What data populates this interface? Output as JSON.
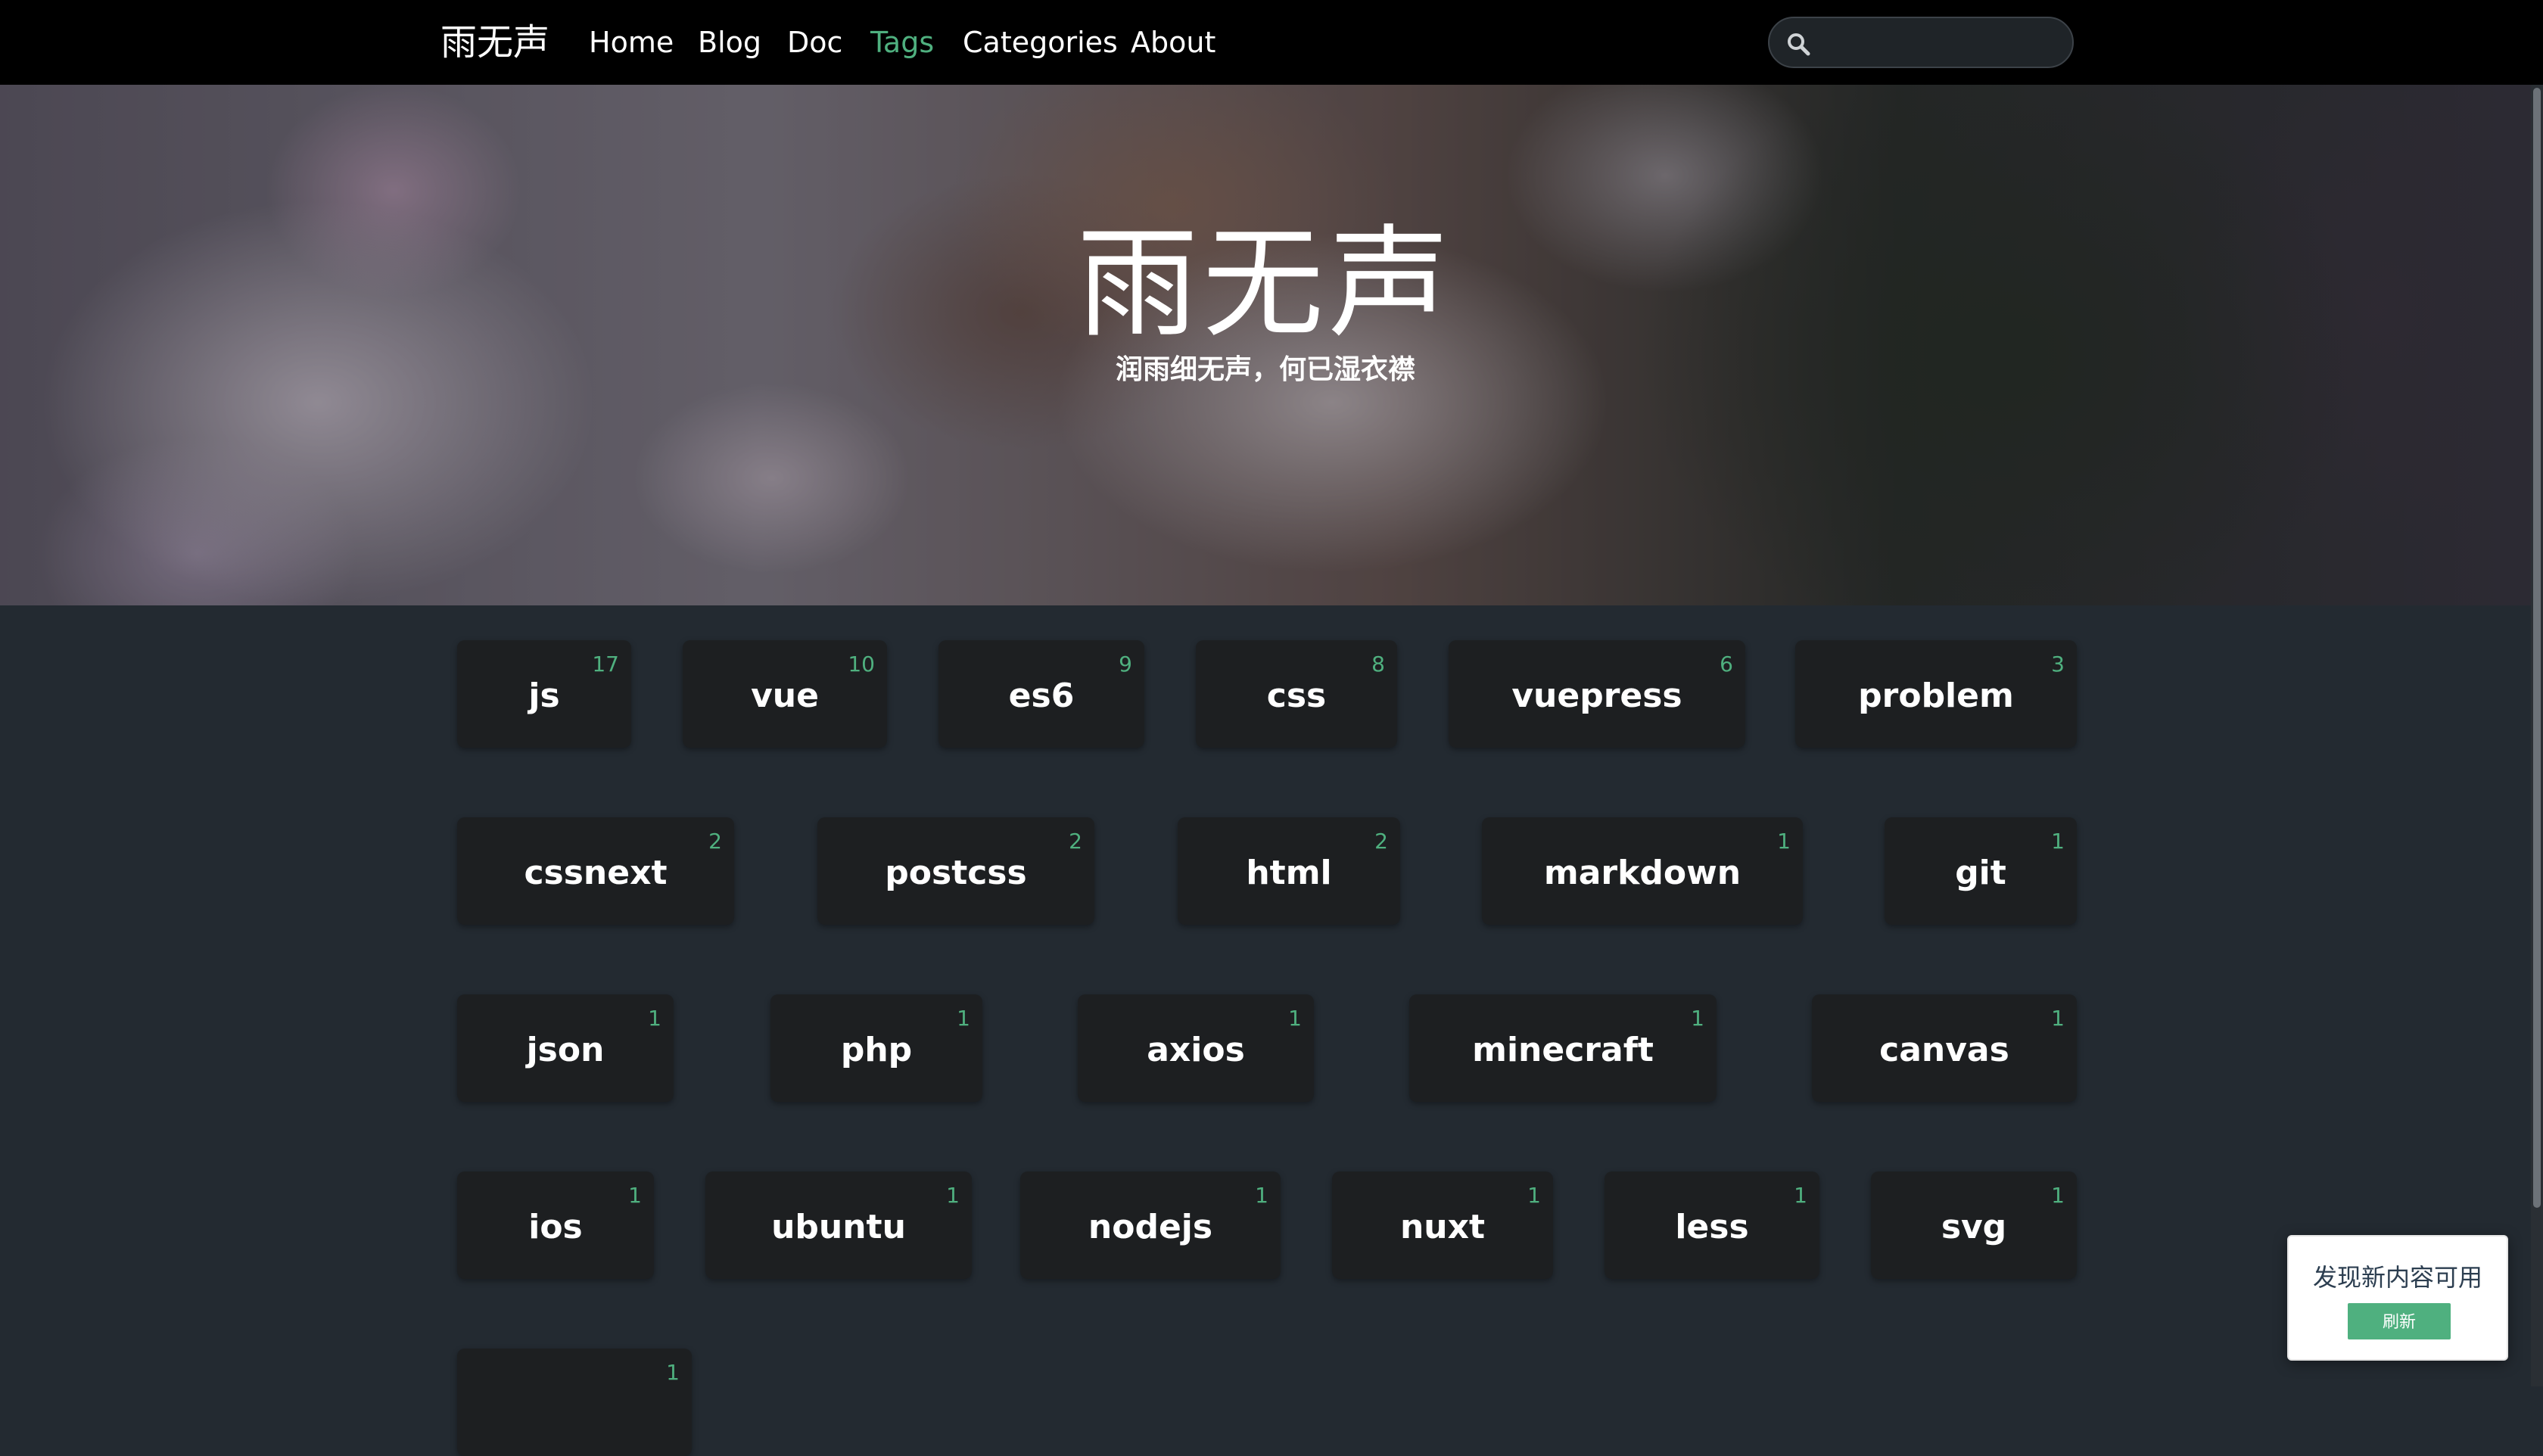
{
  "nav": {
    "brand": "雨无声",
    "links": [
      {
        "label": "Home",
        "active": false
      },
      {
        "label": "Blog",
        "active": false
      },
      {
        "label": "Doc",
        "active": false
      },
      {
        "label": "Tags",
        "active": true
      },
      {
        "label": "Categories",
        "active": false
      },
      {
        "label": "About",
        "active": false
      }
    ],
    "search_value": ""
  },
  "hero": {
    "title": "雨无声",
    "subtitle": "润雨细无声，何已湿衣襟"
  },
  "tags": [
    {
      "name": "js",
      "count": "17"
    },
    {
      "name": "vue",
      "count": "10"
    },
    {
      "name": "es6",
      "count": "9"
    },
    {
      "name": "css",
      "count": "8"
    },
    {
      "name": "vuepress",
      "count": "6"
    },
    {
      "name": "problem",
      "count": "3"
    },
    {
      "name": "cssnext",
      "count": "2"
    },
    {
      "name": "postcss",
      "count": "2"
    },
    {
      "name": "html",
      "count": "2"
    },
    {
      "name": "markdown",
      "count": "1"
    },
    {
      "name": "git",
      "count": "1"
    },
    {
      "name": "json",
      "count": "1"
    },
    {
      "name": "php",
      "count": "1"
    },
    {
      "name": "axios",
      "count": "1"
    },
    {
      "name": "minecraft",
      "count": "1"
    },
    {
      "name": "canvas",
      "count": "1"
    },
    {
      "name": "ios",
      "count": "1"
    },
    {
      "name": "ubuntu",
      "count": "1"
    },
    {
      "name": "nodejs",
      "count": "1"
    },
    {
      "name": "nuxt",
      "count": "1"
    },
    {
      "name": "less",
      "count": "1"
    },
    {
      "name": "svg",
      "count": "1"
    },
    {
      "name": "",
      "count": "1"
    }
  ],
  "popup": {
    "message": "发现新内容可用",
    "button_label": "刷新"
  }
}
